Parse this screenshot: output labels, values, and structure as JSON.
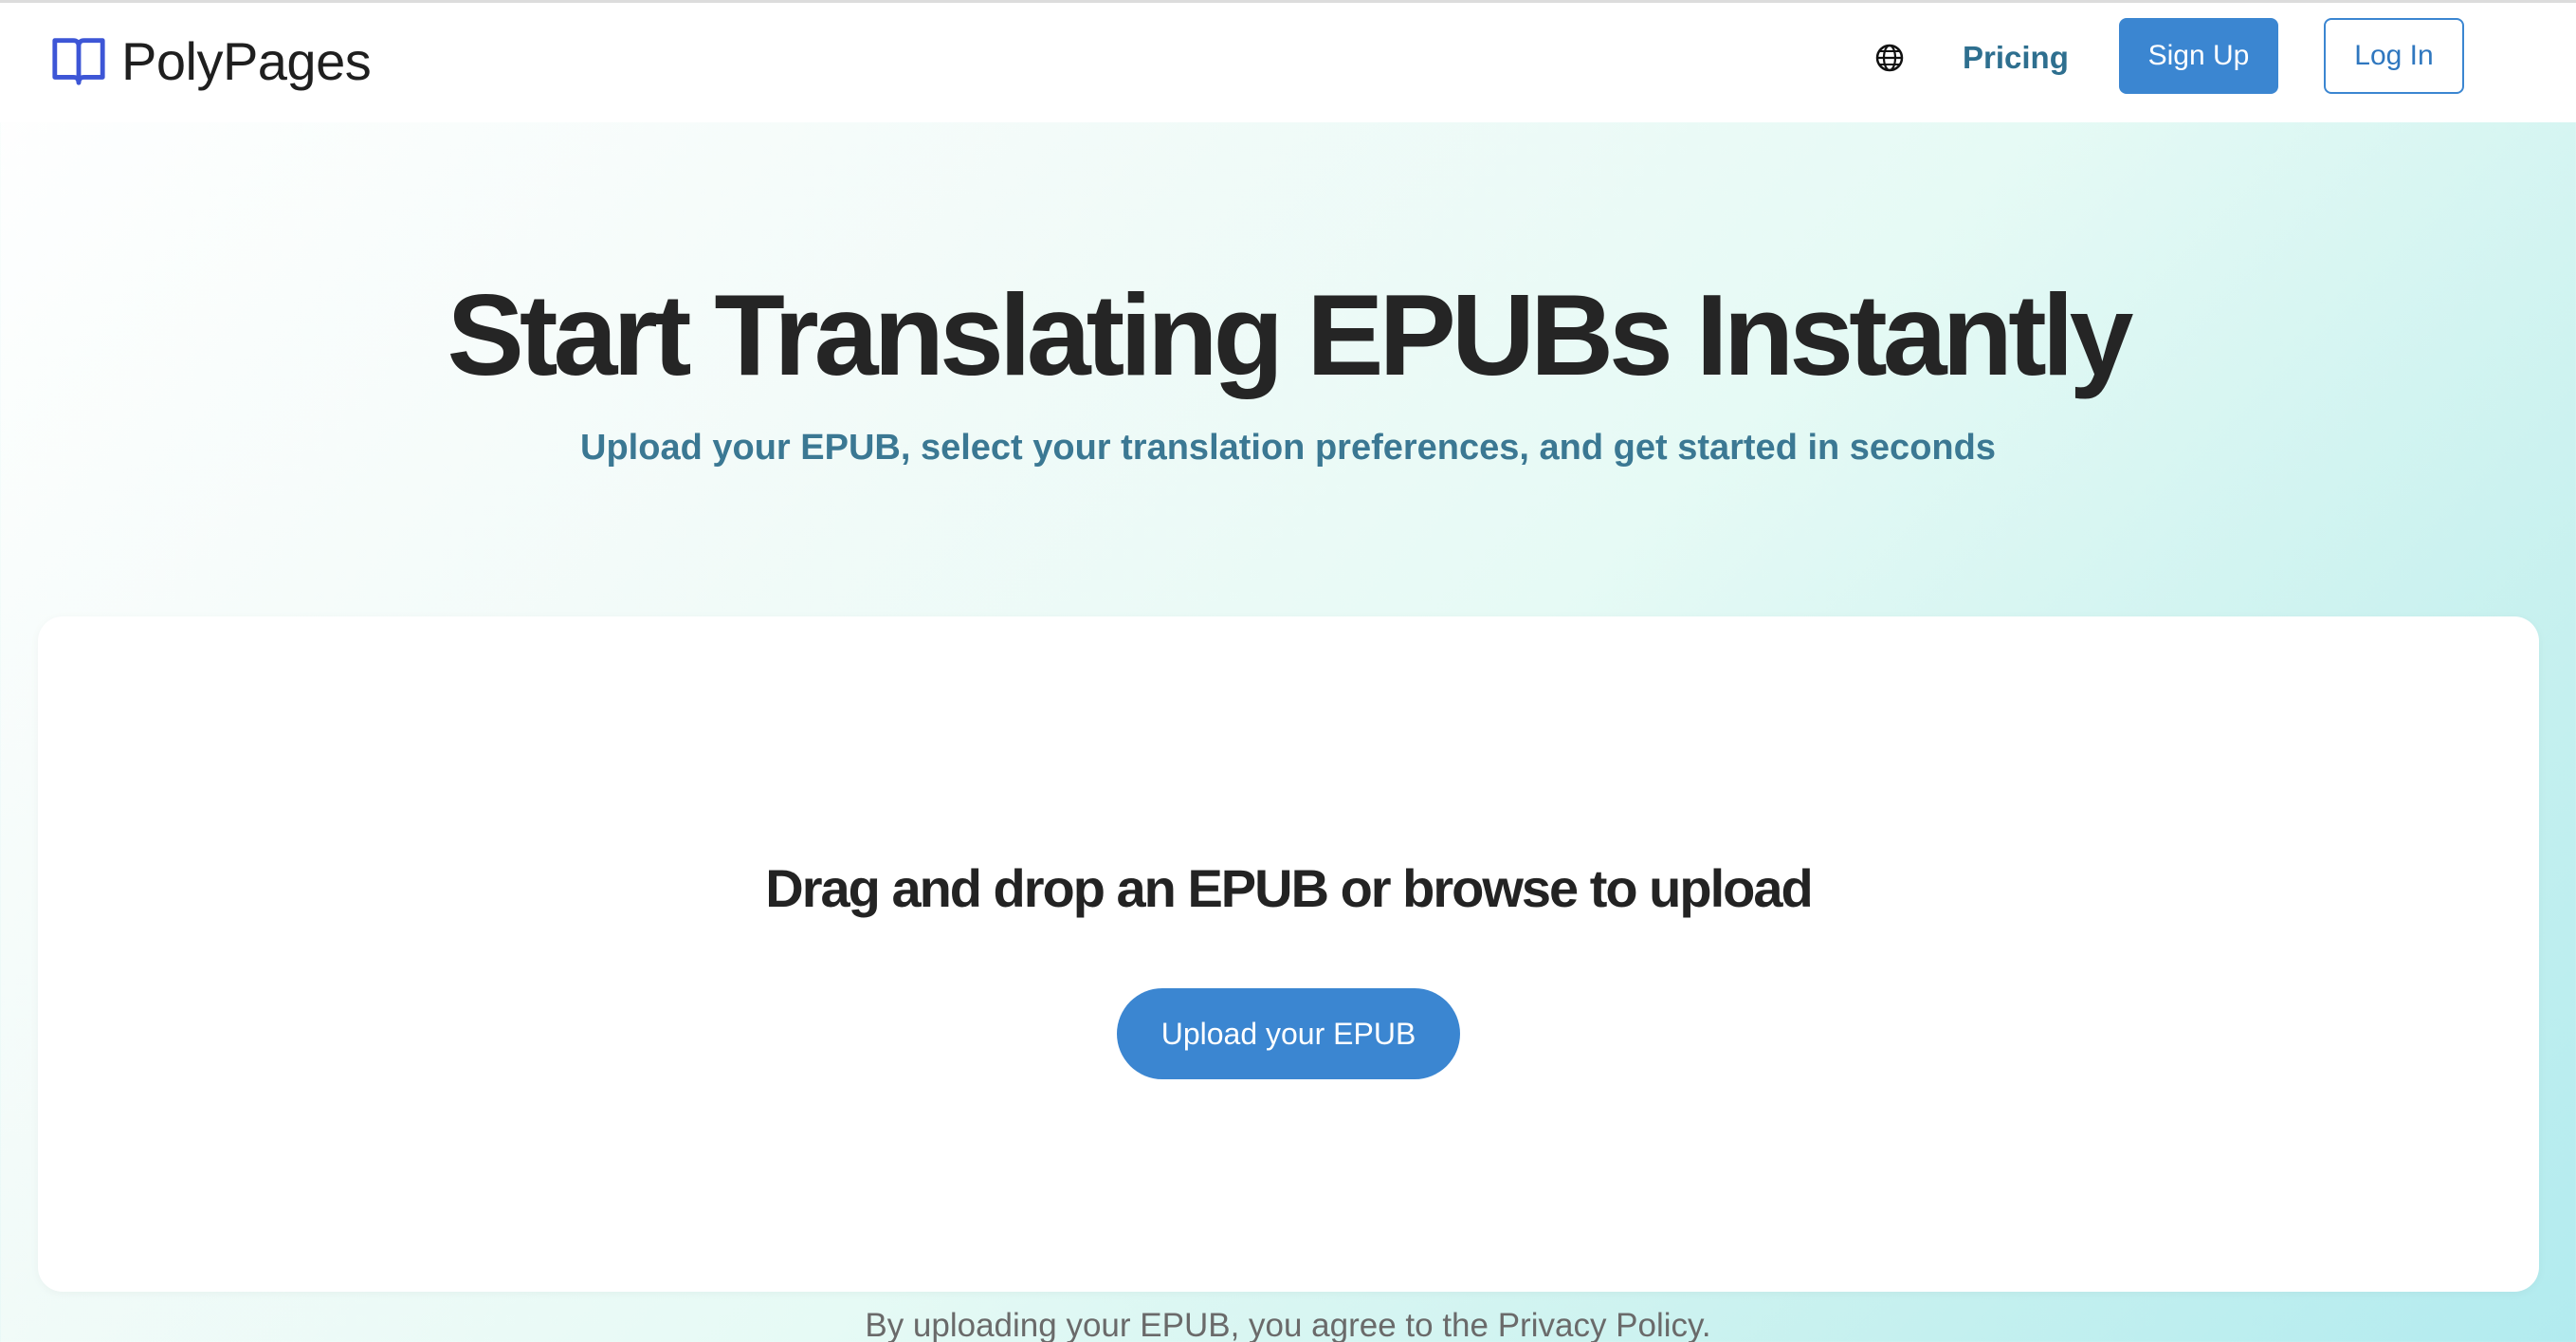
{
  "header": {
    "brand_name": "PolyPages",
    "brand_icon": "open-book-icon",
    "language_icon": "globe-icon",
    "pricing_label": "Pricing",
    "signup_label": "Sign Up",
    "login_label": "Log In"
  },
  "hero": {
    "title": "Start Translating EPUBs Instantly",
    "subtitle": "Upload your EPUB, select your translation preferences, and get started in seconds"
  },
  "upload": {
    "prompt": "Drag and drop an EPUB or browse to upload",
    "button_label": "Upload your EPUB"
  },
  "footer": {
    "agreement": "By uploading your EPUB, you agree to the Privacy Policy."
  },
  "colors": {
    "accent": "#3b86d1",
    "brand_icon": "#3d56d6",
    "subtitle": "#3b7893",
    "pricing": "#2e6f8f"
  }
}
